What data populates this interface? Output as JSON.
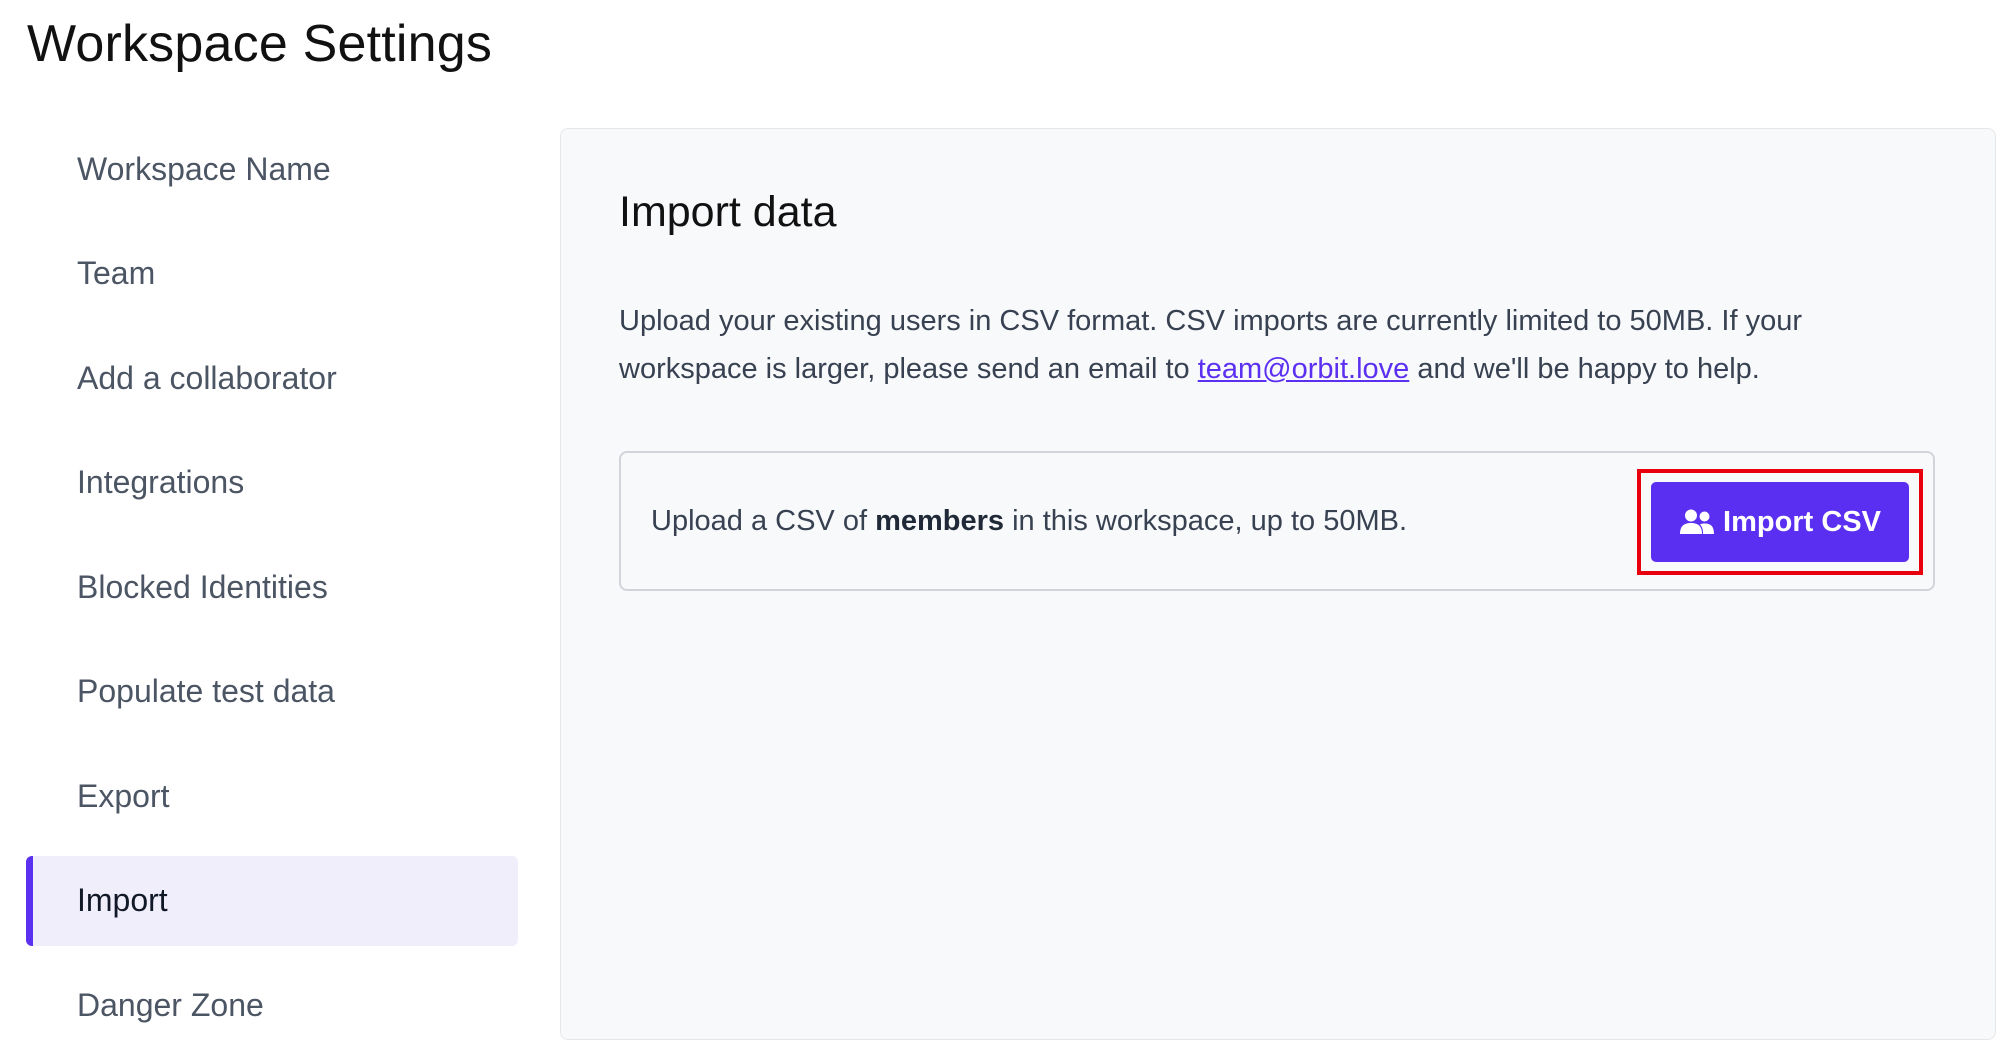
{
  "page": {
    "title": "Workspace Settings"
  },
  "sidebar": {
    "items": [
      {
        "label": "Workspace Name",
        "active": false
      },
      {
        "label": "Team",
        "active": false
      },
      {
        "label": "Add a collaborator",
        "active": false
      },
      {
        "label": "Integrations",
        "active": false
      },
      {
        "label": "Blocked Identities",
        "active": false
      },
      {
        "label": "Populate test data",
        "active": false
      },
      {
        "label": "Export",
        "active": false
      },
      {
        "label": "Import",
        "active": true
      },
      {
        "label": "Danger Zone",
        "active": false
      }
    ]
  },
  "import_panel": {
    "title": "Import data",
    "description_part1": "Upload your existing users in CSV format. CSV imports are currently limited to 50MB. If your workspace is larger, please send an email to ",
    "email_link": "team@orbit.love",
    "description_part2": " and we'll be happy to help.",
    "upload_text_before": "Upload a CSV of ",
    "upload_text_bold": "members",
    "upload_text_after": " in this workspace, up to 50MB.",
    "button_label": "Import CSV",
    "button_icon": "users-icon"
  },
  "colors": {
    "accent": "#5b2ff1",
    "active_bg": "#f1eefc",
    "highlight": "#e8000f",
    "panel_bg": "#f8f9fa"
  }
}
